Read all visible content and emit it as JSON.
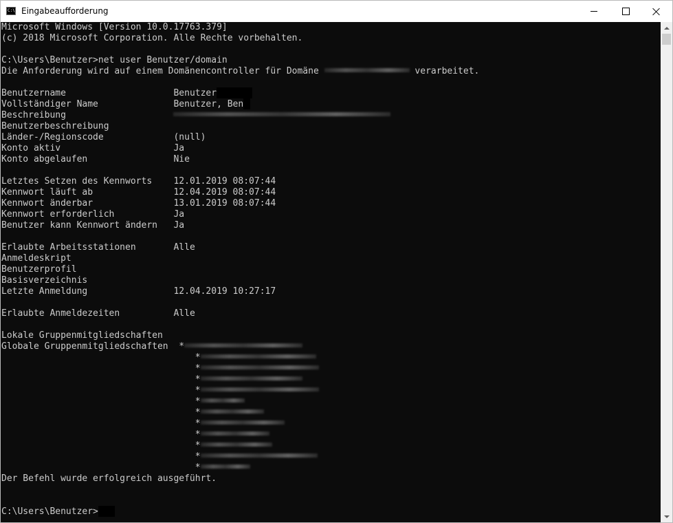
{
  "window": {
    "title": "Eingabeaufforderung",
    "app_icon_label": "C:\\"
  },
  "console": {
    "header_line_1": "Microsoft Windows [Version 10.0.17763.379]",
    "header_line_2": "(c) 2018 Microsoft Corporation. Alle Rechte vorbehalten.",
    "command_prompt": "C:\\Users\\Benutzer>",
    "command": "net user Benutzer/domain",
    "request_prefix": "Die Anforderung wird auf einem Domänencontroller für Domäne ",
    "request_suffix": " verarbeitet.",
    "fields": {
      "benutzername_label": "Benutzername",
      "benutzername_value": "Benutzer",
      "vollstaendiger_name_label": "Vollständiger Name",
      "vollstaendiger_name_value": "Benutzer, Ben",
      "beschreibung_label": "Beschreibung",
      "benutzerbeschreibung_label": "Benutzerbeschreibung",
      "laender_label": "Länder-/Regionscode",
      "laender_value": "(null)",
      "konto_aktiv_label": "Konto aktiv",
      "konto_aktiv_value": "Ja",
      "konto_abgelaufen_label": "Konto abgelaufen",
      "konto_abgelaufen_value": "Nie",
      "letztes_setzen_label": "Letztes Setzen des Kennworts",
      "letztes_setzen_value": "12.01.2019 08:07:44",
      "kennwort_laeuft_ab_label": "Kennwort läuft ab",
      "kennwort_laeuft_ab_value": "12.04.2019 08:07:44",
      "kennwort_aenderbar_label": "Kennwort änderbar",
      "kennwort_aenderbar_value": "13.01.2019 08:07:44",
      "kennwort_erforderlich_label": "Kennwort erforderlich",
      "kennwort_erforderlich_value": "Ja",
      "benutzer_kann_aendern_label": "Benutzer kann Kennwort ändern",
      "benutzer_kann_aendern_value": "Ja",
      "arbeitsstationen_label": "Erlaubte Arbeitsstationen",
      "arbeitsstationen_value": "Alle",
      "anmeldeskript_label": "Anmeldeskript",
      "benutzerprofil_label": "Benutzerprofil",
      "basisverzeichnis_label": "Basisverzeichnis",
      "letzte_anmeldung_label": "Letzte Anmeldung",
      "letzte_anmeldung_value": "12.04.2019 10:27:17",
      "anmeldezeiten_label": "Erlaubte Anmeldezeiten",
      "anmeldezeiten_value": "Alle",
      "lokale_gruppen_label": "Lokale Gruppenmitgliedschaften",
      "globale_gruppen_label": "Globale Gruppenmitgliedschaften",
      "group_marker": "*"
    },
    "success_message": "Der Befehl wurde erfolgreich ausgeführt.",
    "final_prompt": "C:\\Users\\Benutzer>"
  },
  "colors": {
    "console_background": "#0c0c0c",
    "console_text": "#cccccc",
    "titlebar_background": "#ffffff"
  }
}
